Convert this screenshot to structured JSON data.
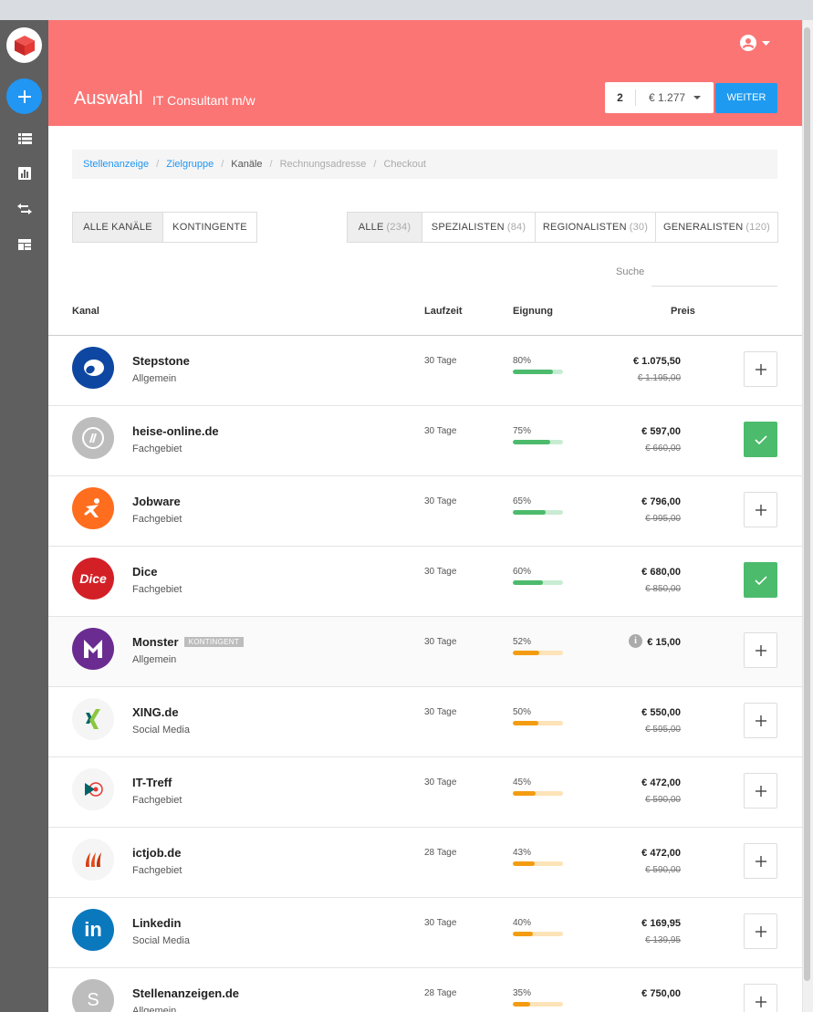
{
  "header": {
    "title": "Auswahl",
    "subtitle": "IT Consultant m/w",
    "cart_count": "2",
    "cart_price": "€ 1.277",
    "weiter_label": "WEITER"
  },
  "breadcrumb": {
    "items": [
      "Stellenanzeige",
      "Zielgruppe",
      "Kanäle",
      "Rechnungsadresse",
      "Checkout"
    ]
  },
  "channel_tabs": {
    "all": "ALLE KANÄLE",
    "kontingente": "KONTINGENTE"
  },
  "filter_tabs": [
    {
      "label": "ALLE",
      "count": "(234)"
    },
    {
      "label": "SPEZIALISTEN",
      "count": "(84)"
    },
    {
      "label": "REGIONALISTEN",
      "count": "(30)"
    },
    {
      "label": "GENERALISTEN",
      "count": "(120)"
    }
  ],
  "search": {
    "label": "Suche",
    "value": ""
  },
  "table": {
    "headers": {
      "kanal": "Kanal",
      "laufzeit": "Laufzeit",
      "eignung": "Eignung",
      "preis": "Preis"
    },
    "rows": [
      {
        "name": "Stepstone",
        "category": "Allgemein",
        "laufzeit": "30 Tage",
        "eignung": "80%",
        "eignung_value": 80,
        "price": "€ 1.075,50",
        "old_price": "€ 1.195,00",
        "selected": false,
        "logo": "stepstone-logo",
        "logo_color": "#0d47a1"
      },
      {
        "name": "heise-online.de",
        "category": "Fachgebiet",
        "laufzeit": "30 Tage",
        "eignung": "75%",
        "eignung_value": 75,
        "price": "€ 597,00",
        "old_price": "€ 660,00",
        "selected": true,
        "logo": "heise-logo",
        "logo_color": "#bdbdbd"
      },
      {
        "name": "Jobware",
        "category": "Fachgebiet",
        "laufzeit": "30 Tage",
        "eignung": "65%",
        "eignung_value": 65,
        "price": "€ 796,00",
        "old_price": "€ 995,00",
        "selected": false,
        "logo": "jobware-logo",
        "logo_color": "#ff6d1f"
      },
      {
        "name": "Dice",
        "category": "Fachgebiet",
        "laufzeit": "30 Tage",
        "eignung": "60%",
        "eignung_value": 60,
        "price": "€ 680,00",
        "old_price": "€ 850,00",
        "selected": true,
        "logo": "dice-logo",
        "logo_color": "#d32027",
        "logo_text": "Dice"
      },
      {
        "name": "Monster",
        "badge": "KONTINGENT",
        "category": "Allgemein",
        "laufzeit": "30 Tage",
        "eignung": "52%",
        "eignung_value": 52,
        "price": "€ 15,00",
        "old_price": "",
        "selected": false,
        "info": true,
        "logo": "monster-logo",
        "logo_color": "#6a2c91"
      },
      {
        "name": "XING.de",
        "category": "Social Media",
        "laufzeit": "30 Tage",
        "eignung": "50%",
        "eignung_value": 50,
        "price": "€ 550,00",
        "old_price": "€ 595,00",
        "selected": false,
        "logo": "xing-logo",
        "logo_color": "#f5f5f5"
      },
      {
        "name": "IT-Treff",
        "category": "Fachgebiet",
        "laufzeit": "30 Tage",
        "eignung": "45%",
        "eignung_value": 45,
        "price": "€ 472,00",
        "old_price": "€ 590,00",
        "selected": false,
        "logo": "ittreff-logo",
        "logo_color": "#f5f5f5"
      },
      {
        "name": "ictjob.de",
        "category": "Fachgebiet",
        "laufzeit": "28 Tage",
        "eignung": "43%",
        "eignung_value": 43,
        "price": "€ 472,00",
        "old_price": "€ 590,00",
        "selected": false,
        "logo": "ictjob-logo",
        "logo_color": "#f5f5f5"
      },
      {
        "name": "Linkedin",
        "category": "Social Media",
        "laufzeit": "30 Tage",
        "eignung": "40%",
        "eignung_value": 40,
        "price": "€ 169,95",
        "old_price": "€ 139,95",
        "selected": false,
        "logo": "linkedin-logo",
        "logo_color": "#0a78bd",
        "logo_text": "in"
      },
      {
        "name": "Stellenanzeigen.de",
        "category": "Allgemein",
        "laufzeit": "28 Tage",
        "eignung": "35%",
        "eignung_value": 35,
        "price": "€ 750,00",
        "old_price": "",
        "selected": false,
        "logo": "stellenanzeigen-logo",
        "logo_color": "#bdbdbd",
        "logo_text": "S"
      }
    ]
  },
  "colors": {
    "header_bg": "#fb7575",
    "primary": "#2196f3",
    "success": "#4cbb6c",
    "bar_green": "#4cbb6c",
    "bar_green_track": "#c8ecd3",
    "bar_orange": "#f39c12",
    "bar_orange_track": "#fde3b8",
    "sidebar": "#5f5f5f"
  }
}
